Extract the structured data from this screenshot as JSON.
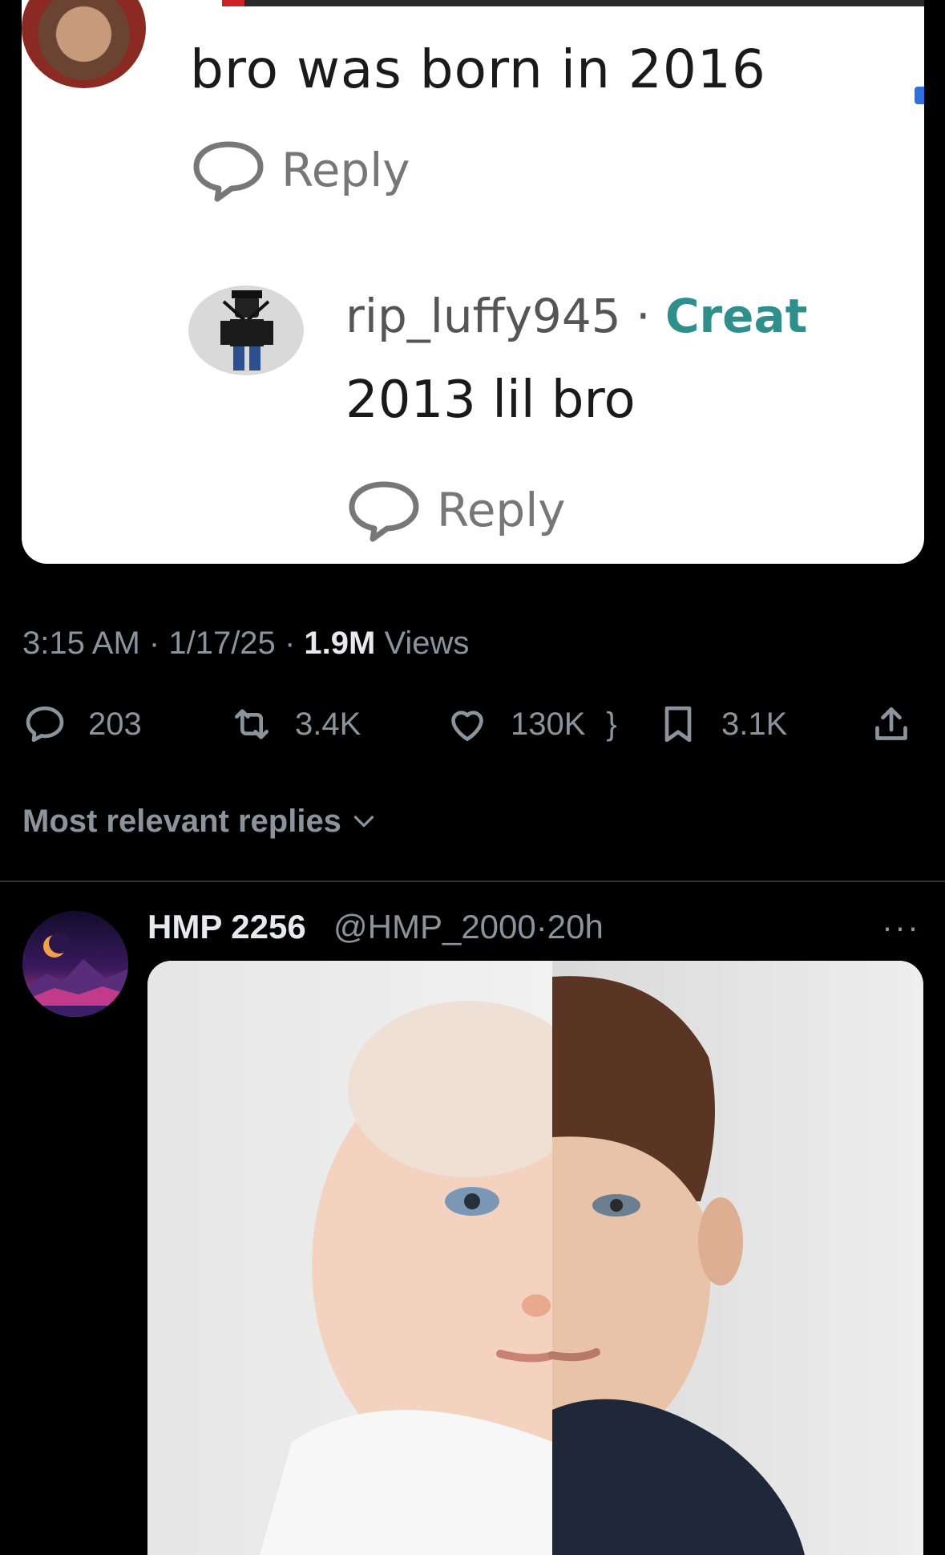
{
  "embedded_card": {
    "comment_1": {
      "avatar": "user-avatar-photo",
      "text": "bro was born in 2016",
      "reply_label": "Reply"
    },
    "comment_2": {
      "avatar": "robot-avatar",
      "username": "rip_luffy945",
      "separator": "·",
      "badge": "Creat",
      "text": "2013 lil bro",
      "reply_label": "Reply"
    }
  },
  "post": {
    "time": "3:15 AM",
    "date": "1/17/25",
    "sep": "·",
    "views_count": "1.9M",
    "views_label": "Views"
  },
  "actions": {
    "replies": "203",
    "reposts": "3.4K",
    "likes": "130K",
    "bookmarks": "3.1K"
  },
  "sort": {
    "label": "Most relevant replies"
  },
  "reply": {
    "display_name": "HMP 2256",
    "handle": "@HMP_2000",
    "sep": "·",
    "time": "20h",
    "more": "···",
    "media": "baby-photo-split-comparison"
  },
  "colors": {
    "background": "#000000",
    "text_primary": "#e7e9ea",
    "text_secondary": "#8b949c",
    "card_bg": "#ffffff",
    "creat_teal": "#2f8f8c"
  }
}
